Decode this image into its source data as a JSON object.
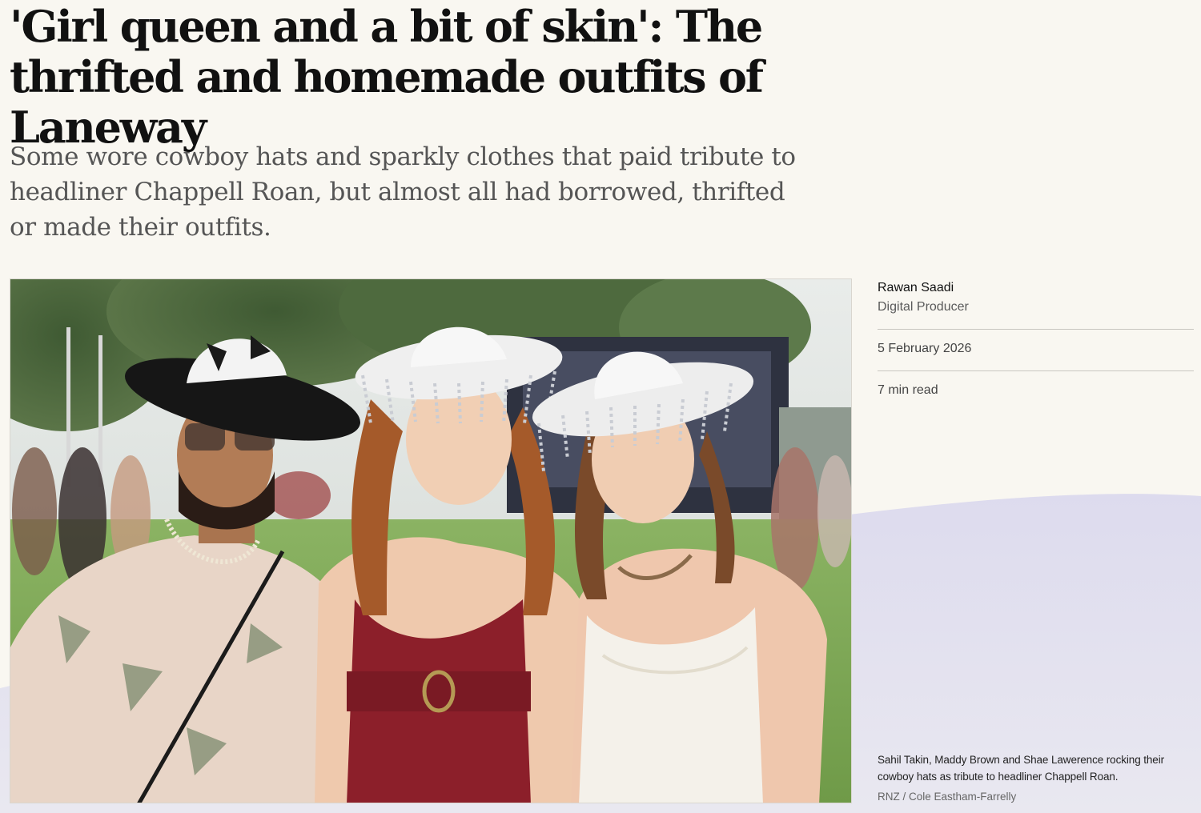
{
  "article": {
    "headline": "'Girl queen and a bit of skin': The thrifted and homemade outfits of Laneway",
    "standfirst": "Some wore cowboy hats and sparkly clothes that paid tribute to headliner Chappell Roan, but almost all had borrowed, thrifted or made their outfits."
  },
  "author": {
    "name": "Rawan Saadi",
    "role": "Digital Producer"
  },
  "meta": {
    "date": "5 February 2026",
    "read_time": "7 min read"
  },
  "image": {
    "caption": "Sahil Takin, Maddy Brown and Shae Lawerence rocking their cowboy hats as tribute to headliner Chappell Roan.",
    "credit": "RNZ / Cole Eastham-Farrelly"
  },
  "colors": {
    "page_background": "#f9f7f1",
    "wave_lavender": "#dedcec",
    "headline": "#111111",
    "standfirst": "#555555"
  }
}
